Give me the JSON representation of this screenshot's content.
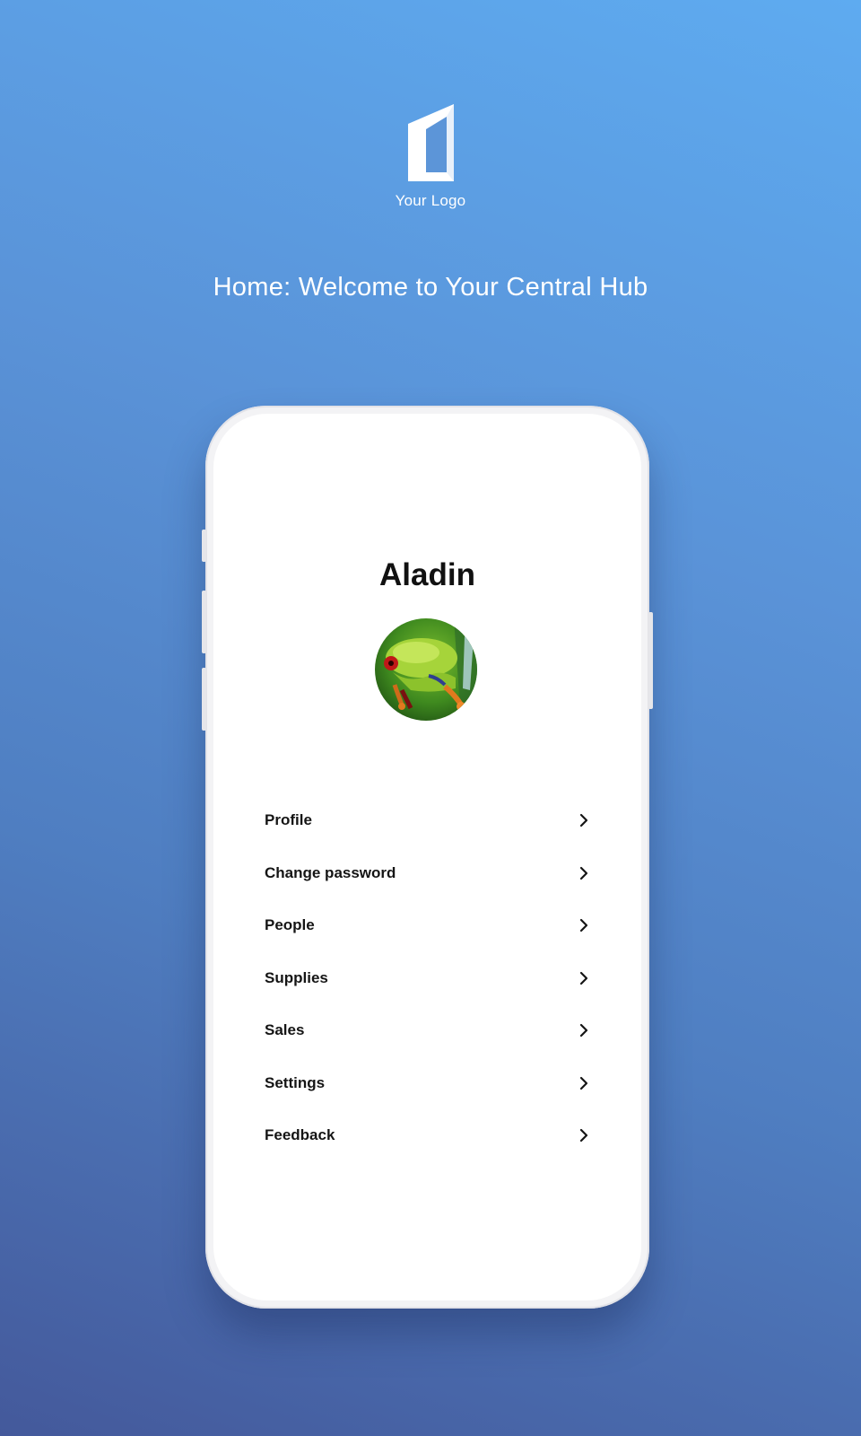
{
  "brand": {
    "logo_text": "Your Logo",
    "logo_icon": "door-logo-icon"
  },
  "headline": "Home: Welcome to Your Central Hub",
  "profile": {
    "name": "Aladin",
    "avatar": "frog-avatar-image"
  },
  "menu": {
    "items": [
      {
        "label": "Profile",
        "icon": "chevron-right-icon"
      },
      {
        "label": "Change password",
        "icon": "chevron-right-icon"
      },
      {
        "label": "People",
        "icon": "chevron-right-icon"
      },
      {
        "label": "Supplies",
        "icon": "chevron-right-icon"
      },
      {
        "label": "Sales",
        "icon": "chevron-right-icon"
      },
      {
        "label": "Settings",
        "icon": "chevron-right-icon"
      },
      {
        "label": "Feedback",
        "icon": "chevron-right-icon"
      }
    ]
  },
  "colors": {
    "background_top": "#5eabf0",
    "background_bottom": "#44599b",
    "screen": "#ffffff",
    "text": "#151515"
  }
}
